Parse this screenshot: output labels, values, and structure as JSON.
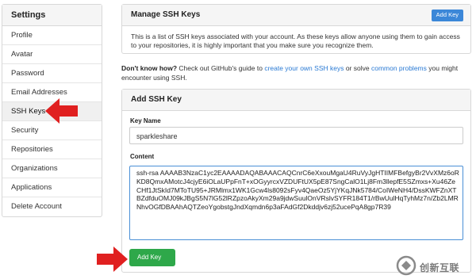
{
  "sidebar": {
    "title": "Settings",
    "items": [
      {
        "label": "Profile"
      },
      {
        "label": "Avatar"
      },
      {
        "label": "Password"
      },
      {
        "label": "Email Addresses"
      },
      {
        "label": "SSH Keys"
      },
      {
        "label": "Security"
      },
      {
        "label": "Repositories"
      },
      {
        "label": "Organizations"
      },
      {
        "label": "Applications"
      },
      {
        "label": "Delete Account"
      }
    ]
  },
  "manage_panel": {
    "title": "Manage SSH Keys",
    "add_button": "Add Key",
    "description": "This is a list of SSH keys associated with your account. As these keys allow anyone using them to gain access to your repositories, it is highly important that you make sure you recognize them."
  },
  "help_note": {
    "bold": "Don't know how?",
    "text1": " Check out GitHub's guide to ",
    "link1": "create your own SSH keys",
    "text2": " or solve ",
    "link2": "common problems",
    "text3": " you might encounter using SSH."
  },
  "add_panel": {
    "title": "Add SSH Key",
    "key_name_label": "Key Name",
    "key_name_value": "sparkleshare",
    "content_label": "Content",
    "content_value": "ssh-rsa AAAAB3NzaC1yc2EAAAADAQABAAACAQCnrC6eXxouMgaU4RuVyJgHTIIMFBefgyBr2VvXMz6oRKD8QmxAMotcJ4cjyE6iOLaUPpFnT+xOGyyrcxVZDUFtUX5pE87SngCalO1Lj8Fm3llepfE5SZmxs+Xu46ZeCHf1JtSkId7MToTU95+JRMlmx1WK1Gcw4ls8092sFyv4QaeOz5YjYKqJNk5784/CoIWeNH4/DssKWFZnXTBZdfduOMJ09kJBgS5N7lG52lRZpzoAkyXm29a9jdwSuulOnVRslvSYFR184T1/rBwUulHqTyhMz7n/Zb2LMRNhvOGfDBAAhAQTZeoYgobstgJndXqmdn6p3aFAdGf2Dkddjv6zj52ucePqA8gp7R39",
    "submit_button": "Add Key"
  },
  "watermark": {
    "text": "创新互联"
  },
  "colors": {
    "accent_blue": "#3b87d8",
    "link_blue": "#2a7ad4",
    "submit_green": "#2ea84a",
    "arrow_red": "#e02020"
  }
}
